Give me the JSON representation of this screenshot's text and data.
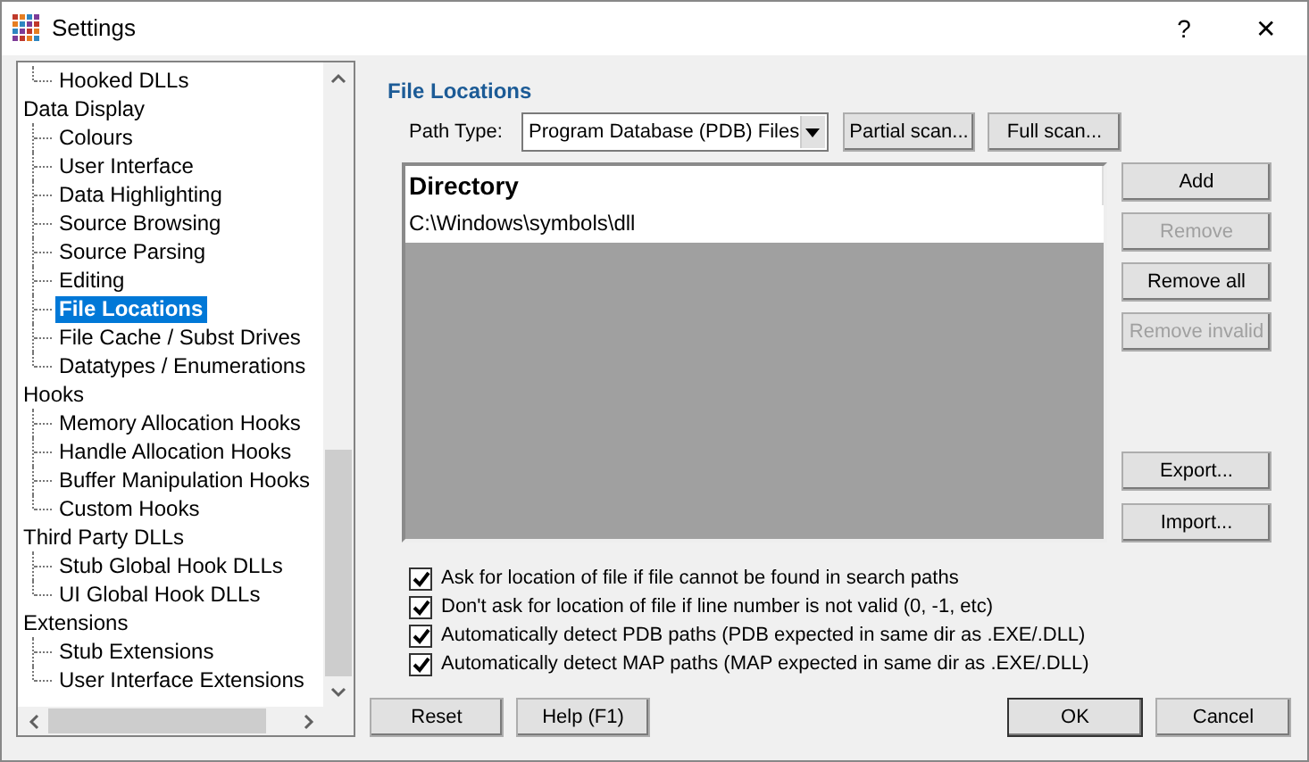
{
  "window": {
    "title": "Settings",
    "help_button": "?",
    "close_button": "✕"
  },
  "tree": [
    {
      "children": [
        {
          "label": "Hooked DLLs",
          "selected": false
        }
      ]
    },
    {
      "label": "Data Display",
      "children": [
        {
          "label": "Colours",
          "selected": false
        },
        {
          "label": "User Interface",
          "selected": false
        },
        {
          "label": "Data Highlighting",
          "selected": false
        },
        {
          "label": "Source Browsing",
          "selected": false
        },
        {
          "label": "Source Parsing",
          "selected": false
        },
        {
          "label": "Editing",
          "selected": false
        },
        {
          "label": "File Locations",
          "selected": true
        },
        {
          "label": "File Cache / Subst Drives",
          "selected": false
        },
        {
          "label": "Datatypes / Enumerations",
          "selected": false
        }
      ]
    },
    {
      "label": "Hooks",
      "children": [
        {
          "label": "Memory Allocation Hooks",
          "selected": false
        },
        {
          "label": "Handle Allocation Hooks",
          "selected": false
        },
        {
          "label": "Buffer Manipulation Hooks",
          "selected": false
        },
        {
          "label": "Custom Hooks",
          "selected": false
        }
      ]
    },
    {
      "label": "Third Party DLLs",
      "children": [
        {
          "label": "Stub Global Hook DLLs",
          "selected": false
        },
        {
          "label": "UI Global Hook DLLs",
          "selected": false
        }
      ]
    },
    {
      "label": "Extensions",
      "children": [
        {
          "label": "Stub Extensions",
          "selected": false
        },
        {
          "label": "User Interface Extensions",
          "selected": false
        }
      ]
    }
  ],
  "panel": {
    "title": "File Locations",
    "path_type_label": "Path Type:",
    "path_type_value": "Program Database (PDB) Files",
    "scan_buttons": [
      "Partial scan...",
      "Full scan..."
    ],
    "table": {
      "columns": [
        "Directory"
      ],
      "rows": [
        [
          "C:\\Windows\\symbols\\dll"
        ]
      ]
    },
    "side_buttons": [
      {
        "label": "Add",
        "disabled": false
      },
      {
        "label": "Remove",
        "disabled": true
      },
      {
        "label": "Remove all",
        "disabled": false
      },
      {
        "label": "Remove invalid",
        "disabled": true
      }
    ],
    "lower_buttons": [
      {
        "label": "Export...",
        "disabled": false
      },
      {
        "label": "Import...",
        "disabled": false
      }
    ],
    "options": [
      {
        "label": "Ask for location of file if file cannot be found in search paths",
        "checked": true
      },
      {
        "label": "Don't ask for location of file if line number is not valid (0, -1, etc)",
        "checked": true
      },
      {
        "label": "Automatically detect PDB paths (PDB expected in same dir as .EXE/.DLL)",
        "checked": true
      },
      {
        "label": "Automatically detect MAP paths (MAP expected in same dir as .EXE/.DLL)",
        "checked": true
      }
    ]
  },
  "footer": {
    "left_buttons": [
      "Reset",
      "Help (F1)"
    ],
    "right_buttons": [
      "OK",
      "Cancel"
    ]
  }
}
